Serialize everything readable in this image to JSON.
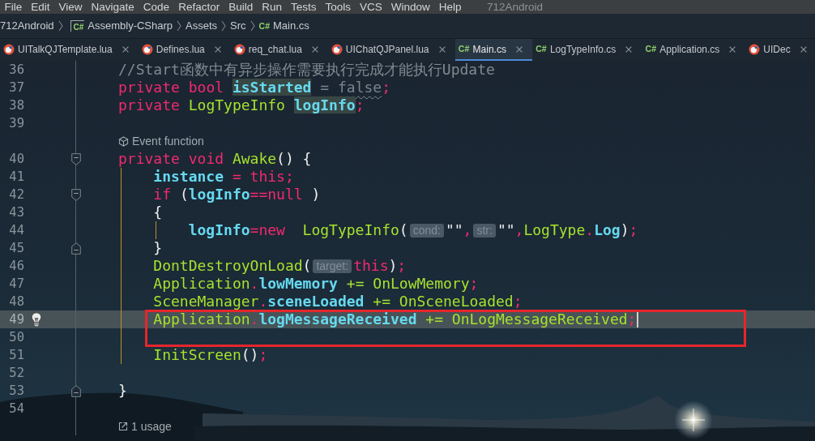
{
  "menu_bar": {
    "items": [
      "File",
      "Edit",
      "View",
      "Navigate",
      "Code",
      "Refactor",
      "Build",
      "Run",
      "Tests",
      "Tools",
      "VCS",
      "Window",
      "Help"
    ],
    "title": "712Android"
  },
  "breadcrumb": [
    {
      "label": "712Android",
      "kind": "plain"
    },
    {
      "label": "Assembly-CSharp",
      "kind": "project",
      "badge": "C#"
    },
    {
      "label": "Assets",
      "kind": "plain"
    },
    {
      "label": "Src",
      "kind": "plain"
    },
    {
      "label": "Main.cs",
      "kind": "file",
      "badge": "C#"
    }
  ],
  "tabs": [
    {
      "label": "UITalkQJTemplate.lua",
      "kind": "lua",
      "selected": false
    },
    {
      "label": "Defines.lua",
      "kind": "lua",
      "selected": false
    },
    {
      "label": "req_chat.lua",
      "kind": "lua",
      "selected": false
    },
    {
      "label": "UIChatQJPanel.lua",
      "kind": "lua",
      "selected": false
    },
    {
      "label": "Main.cs",
      "kind": "csharp",
      "badge": "C#",
      "selected": true
    },
    {
      "label": "LogTypeInfo.cs",
      "kind": "csharp",
      "badge": "C#",
      "selected": false
    },
    {
      "label": "Application.cs",
      "kind": "csharp",
      "badge": "C#",
      "selected": false
    },
    {
      "label": "UIDec",
      "kind": "lua",
      "selected": false
    }
  ],
  "editor": {
    "rows": [
      {
        "kind": "line",
        "number": "36",
        "current": false,
        "tokens": [
          {
            "text": "//Start函数中有异步操作需要执行完成才能执行Update",
            "kind": "comment"
          }
        ]
      },
      {
        "kind": "line",
        "number": "37",
        "current": false,
        "tokens": [
          {
            "text": "private ",
            "kind": "keyword"
          },
          {
            "text": "bool ",
            "kind": "keyword"
          },
          {
            "text": "isStarted",
            "kind": "usage"
          },
          {
            "text": " = false",
            "kind": "dim"
          },
          {
            "text": ";",
            "kind": "punct"
          }
        ]
      },
      {
        "kind": "line",
        "number": "38",
        "current": false,
        "tokens": [
          {
            "text": "private ",
            "kind": "keyword"
          },
          {
            "text": "LogTypeInfo ",
            "kind": "type"
          },
          {
            "text": "logInfo",
            "kind": "usage"
          },
          {
            "text": ";",
            "kind": "punct"
          }
        ]
      },
      {
        "kind": "line",
        "number": "39",
        "current": false
      },
      {
        "kind": "event_hint",
        "label": "Event function"
      },
      {
        "kind": "line",
        "number": "40",
        "current": false,
        "fold": {
          "kind": "start"
        },
        "tokens": [
          {
            "text": "private ",
            "kind": "keyword"
          },
          {
            "text": "void ",
            "kind": "keyword"
          },
          {
            "text": "Awake",
            "kind": "call"
          },
          {
            "text": "() {",
            "kind": "plain"
          }
        ],
        "children": [
          {
            "kind": "line",
            "number": "41",
            "current": false,
            "tokens": [
              {
                "text": "instance",
                "kind": "member"
              },
              {
                "text": " = ",
                "kind": "operator"
              },
              {
                "text": "this",
                "kind": "keyword"
              },
              {
                "text": ";",
                "kind": "punct"
              }
            ]
          },
          {
            "kind": "line",
            "number": "42",
            "current": false,
            "fold": {
              "kind": "start"
            },
            "tokens": [
              {
                "text": "if ",
                "kind": "keyword"
              },
              {
                "text": "(",
                "kind": "plain"
              },
              {
                "text": "logInfo",
                "kind": "member"
              },
              {
                "text": "==",
                "kind": "operator"
              },
              {
                "text": "null",
                "kind": "keyword"
              },
              {
                "text": " )",
                "kind": "plain"
              }
            ]
          },
          {
            "kind": "line",
            "number": "43",
            "current": false,
            "tokens": [
              {
                "text": "{",
                "kind": "plain"
              }
            ],
            "children": [
              {
                "kind": "line",
                "number": "44",
                "current": false,
                "tokens": [
                  {
                    "text": "logInfo",
                    "kind": "member"
                  },
                  {
                    "text": "=",
                    "kind": "operator"
                  },
                  {
                    "text": "new  ",
                    "kind": "keyword"
                  },
                  {
                    "text": "LogTypeInfo",
                    "kind": "type"
                  },
                  {
                    "text": "(",
                    "kind": "plain"
                  },
                  {
                    "text": "cond:",
                    "kind": "hint"
                  },
                  {
                    "text": "\"\"",
                    "kind": "string"
                  },
                  {
                    "text": ",",
                    "kind": "punct"
                  },
                  {
                    "text": "str:",
                    "kind": "hint"
                  },
                  {
                    "text": "\"\"",
                    "kind": "string"
                  },
                  {
                    "text": ",",
                    "kind": "punct"
                  },
                  {
                    "text": "LogType",
                    "kind": "type"
                  },
                  {
                    "text": ".",
                    "kind": "punct"
                  },
                  {
                    "text": "Log",
                    "kind": "member"
                  },
                  {
                    "text": ")",
                    "kind": "plain"
                  },
                  {
                    "text": ";",
                    "kind": "punct"
                  }
                ]
              }
            ]
          },
          {
            "kind": "line",
            "number": "45",
            "current": false,
            "fold": {
              "kind": "end"
            },
            "tokens": [
              {
                "text": "}",
                "kind": "plain"
              }
            ]
          },
          {
            "kind": "line",
            "number": "46",
            "current": false,
            "tokens": [
              {
                "text": "DontDestroyOnLoad",
                "kind": "call"
              },
              {
                "text": "(",
                "kind": "plain"
              },
              {
                "text": "target:",
                "kind": "hint"
              },
              {
                "text": "this",
                "kind": "keyword"
              },
              {
                "text": ")",
                "kind": "plain"
              },
              {
                "text": ";",
                "kind": "punct"
              }
            ]
          },
          {
            "kind": "line",
            "number": "47",
            "current": false,
            "tokens": [
              {
                "text": "Application",
                "kind": "type"
              },
              {
                "text": ".",
                "kind": "punct"
              },
              {
                "text": "lowMemory",
                "kind": "member"
              },
              {
                "text": " += ",
                "kind": "event_op"
              },
              {
                "text": "OnLowMemory",
                "kind": "call"
              },
              {
                "text": ";",
                "kind": "punct"
              }
            ]
          },
          {
            "kind": "line",
            "number": "48",
            "current": false,
            "tokens": [
              {
                "text": "SceneManager",
                "kind": "type"
              },
              {
                "text": ".",
                "kind": "punct"
              },
              {
                "text": "sceneLoaded",
                "kind": "member"
              },
              {
                "text": " += ",
                "kind": "event_op"
              },
              {
                "text": "OnSceneLoaded",
                "kind": "call"
              },
              {
                "text": ";",
                "kind": "punct"
              }
            ]
          },
          {
            "kind": "line",
            "number": "49",
            "current": true,
            "tokens": [
              {
                "text": "Application",
                "kind": "type"
              },
              {
                "text": ".",
                "kind": "punct"
              },
              {
                "text": "logMessageReceived",
                "kind": "member"
              },
              {
                "text": " += ",
                "kind": "event_op"
              },
              {
                "text": "OnLogMessageReceived",
                "kind": "call"
              },
              {
                "text": ";",
                "kind": "punct"
              }
            ]
          },
          {
            "kind": "line",
            "number": "50",
            "current": false
          },
          {
            "kind": "line",
            "number": "51",
            "current": false,
            "tokens": [
              {
                "text": "InitScreen",
                "kind": "call"
              },
              {
                "text": "()",
                "kind": "plain"
              },
              {
                "text": ";",
                "kind": "punct"
              }
            ]
          },
          {
            "kind": "line",
            "number": "52",
            "current": false
          }
        ]
      },
      {
        "kind": "line",
        "number": "53",
        "current": false,
        "fold": {
          "kind": "end"
        },
        "tokens": [
          {
            "text": "}",
            "kind": "plain"
          }
        ]
      },
      {
        "kind": "line",
        "number": "54",
        "current": false
      },
      {
        "kind": "usage_hint",
        "label": "1 usage"
      }
    ]
  }
}
